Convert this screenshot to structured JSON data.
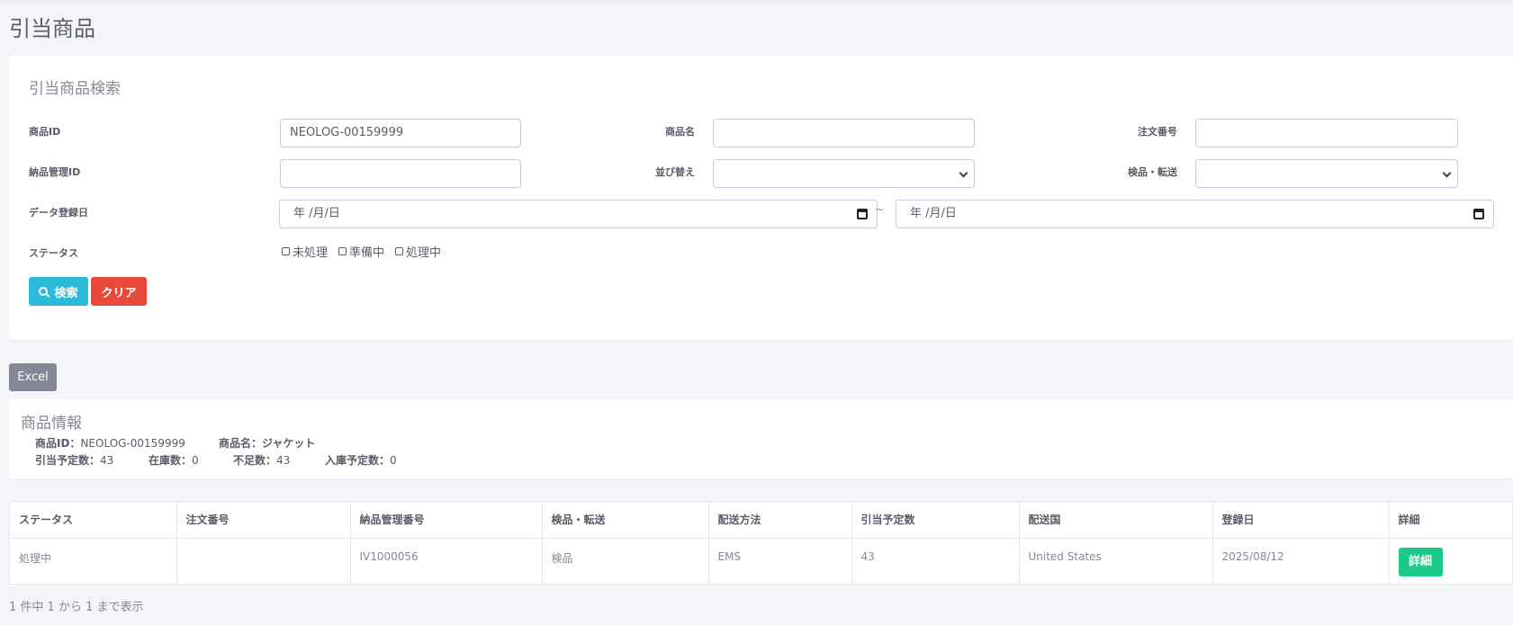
{
  "page": {
    "title": "引当商品"
  },
  "search": {
    "title": "引当商品検索",
    "product_id": {
      "label": "商品ID",
      "value": "NEOLOG-00159999"
    },
    "product_name": {
      "label": "商品名",
      "value": ""
    },
    "order_number": {
      "label": "注文番号",
      "value": ""
    },
    "delivery_id": {
      "label": "納品管理ID",
      "value": ""
    },
    "sort": {
      "label": "並び替え",
      "value": ""
    },
    "inspect_transfer": {
      "label": "検品・転送",
      "value": ""
    },
    "reg_date": {
      "label": "データ登録日",
      "from": "年 /月/日",
      "to": "年 /月/日",
      "sep": "~"
    },
    "status": {
      "label": "ステータス",
      "options": [
        "未処理",
        "準備中",
        "処理中"
      ]
    },
    "search_button": "検索",
    "clear_button": "クリア"
  },
  "excel_button": "Excel",
  "info": {
    "title": "商品情報",
    "product_id_label": "商品ID：",
    "product_id": "NEOLOG-00159999",
    "product_name_label": "商品名：",
    "product_name": "ジャケット",
    "planned_label": "引当予定数：",
    "planned": "43",
    "stock_label": "在庫数：",
    "stock": "0",
    "shortage_label": "不足数：",
    "shortage": "43",
    "incoming_label": "入庫予定数：",
    "incoming": "0"
  },
  "table": {
    "headers": [
      "ステータス",
      "注文番号",
      "納品管理番号",
      "検品・転送",
      "配送方法",
      "引当予定数",
      "配送国",
      "登録日",
      "詳細"
    ],
    "rows": [
      {
        "status": "処理中",
        "order": "",
        "delivery": "IV1000056",
        "inspect": "検品",
        "method": "EMS",
        "qty": "43",
        "country": "United States",
        "date": "2025/08/12",
        "detail": "詳細"
      }
    ]
  },
  "footer": "1 件中 1 から 1 まで表示",
  "colors": {
    "search_button": "#2bbbd8",
    "clear_button": "#e74a3b",
    "excel_button": "#858796",
    "detail_button": "#1cc88a"
  },
  "icons": {
    "search": "search-icon",
    "calendar": "calendar-icon",
    "dropdown": "chevron-down-icon"
  }
}
